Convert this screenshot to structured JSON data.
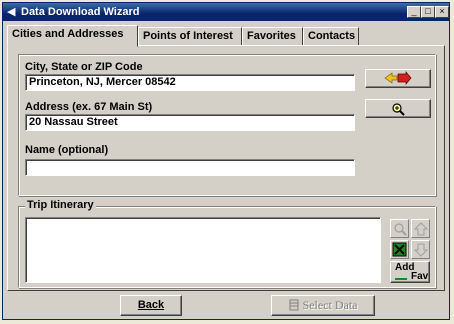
{
  "window": {
    "title": "Data Download Wizard"
  },
  "tabs": [
    {
      "label": "Cities and Addresses",
      "active": true
    },
    {
      "label": "Points of Interest",
      "active": false
    },
    {
      "label": "Favorites",
      "active": false
    },
    {
      "label": "Contacts",
      "active": false
    }
  ],
  "form": {
    "city_label": "City, State or ZIP Code",
    "city_value": "Princeton, NJ, Mercer 08542",
    "address_label": "Address (ex. 67 Main St)",
    "address_value": "20 Nassau Street",
    "name_label": "Name (optional)",
    "name_value": ""
  },
  "itinerary": {
    "legend": "Trip Itinerary",
    "add_fav_line1": "Add",
    "add_fav_line2": "Fav"
  },
  "footer": {
    "back_label": "Back",
    "select_label": "Select Data"
  },
  "colors": {
    "titlebar": "#0a246a",
    "face": "#d4d0c8",
    "delete_icon": "#1a8a1a"
  },
  "icons": [
    "add-to-itinerary-icon",
    "find-location-icon",
    "zoom-icon",
    "up-arrow-icon",
    "delete-icon",
    "down-arrow-icon",
    "select-data-icon"
  ]
}
